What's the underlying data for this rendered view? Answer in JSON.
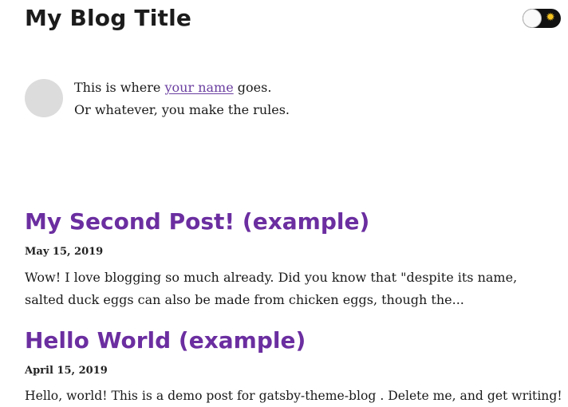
{
  "header": {
    "site_title": "My Blog Title",
    "theme_toggle": {
      "state": "light",
      "icon_sun": "sun-icon",
      "icon_moon": "moon-icon"
    }
  },
  "bio": {
    "avatar": "avatar",
    "line1_before": "This is where ",
    "line1_link": "your name",
    "line1_after": " goes.",
    "line2": "Or whatever, you make the rules."
  },
  "posts": [
    {
      "title": "My Second Post! (example)",
      "date": "May 15, 2019",
      "excerpt": "Wow! I love blogging so much already. Did you know that \"despite its name, salted duck eggs can also be made from chicken eggs, though the..."
    },
    {
      "title": "Hello World (example)",
      "date": "April 15, 2019",
      "excerpt": "Hello, world! This is a demo post for gatsby-theme-blog . Delete me, and get writing!"
    }
  ],
  "colors": {
    "post_title": "#6b2ea0",
    "link": "#6b3fa0",
    "text": "#1a1a1a",
    "toggle_bg": "#111111",
    "sun": "#f4c21f",
    "avatar_bg": "#dcdcdc"
  }
}
